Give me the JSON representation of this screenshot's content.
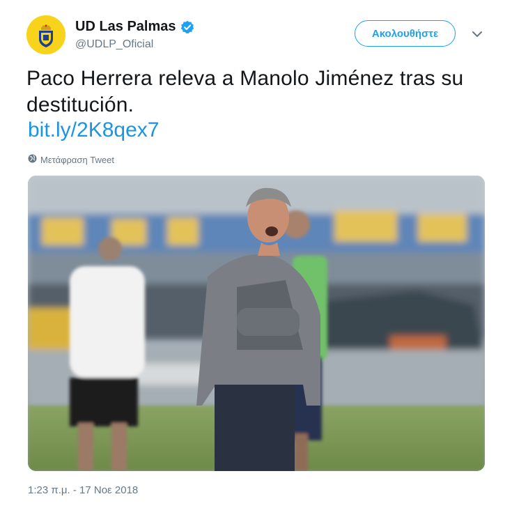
{
  "account": {
    "name": "UD Las Palmas",
    "handle": "@UDLP_Oficial",
    "verified": true
  },
  "actions": {
    "follow_label": "Ακολουθήστε"
  },
  "tweet": {
    "text": "Paco Herrera releva a Manolo Jiménez tras su destitución.",
    "link": "bit.ly/2K8qex7",
    "translate_label": "Μετάφραση Tweet",
    "timestamp": "1:23 π.μ. - 17 Νοε 2018"
  },
  "colors": {
    "accent": "#1da1f2",
    "link": "#1b95e0",
    "secondary_text": "#657786"
  },
  "icons": {
    "verified": "verified-badge-icon",
    "caret": "chevron-down-icon",
    "translate": "globe-icon"
  }
}
